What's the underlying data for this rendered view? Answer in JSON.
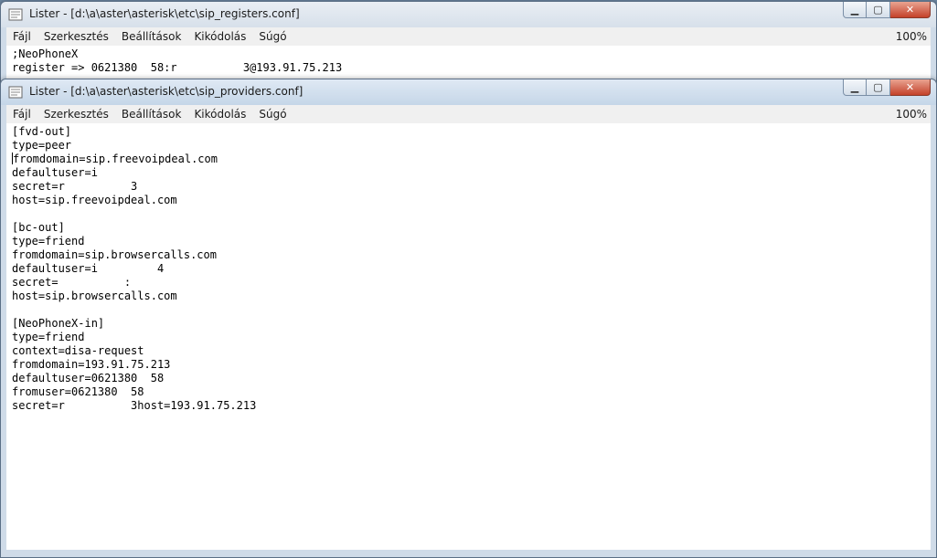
{
  "window_back": {
    "title": "Lister - [d:\\a\\aster\\asterisk\\etc\\sip_registers.conf]",
    "menu": [
      "Fájl",
      "Szerkesztés",
      "Beállítások",
      "Kikódolás",
      "Súgó"
    ],
    "zoom": "100%",
    "lines": [
      ";NeoPhoneX",
      "register => 0621380  58:r          3@193.91.75.213"
    ]
  },
  "window_front": {
    "title": "Lister - [d:\\a\\aster\\asterisk\\etc\\sip_providers.conf]",
    "menu": [
      "Fájl",
      "Szerkesztés",
      "Beállítások",
      "Kikódolás",
      "Súgó"
    ],
    "zoom": "100%",
    "lines": [
      "[fvd-out]",
      "type=peer",
      "fromdomain=sip.freevoipdeal.com",
      "defaultuser=i",
      "secret=r          3",
      "host=sip.freevoipdeal.com",
      "",
      "[bc-out]",
      "type=friend",
      "fromdomain=sip.browsercalls.com",
      "defaultuser=i         4",
      "secret=          :",
      "host=sip.browsercalls.com",
      "",
      "[NeoPhoneX-in]",
      "type=friend",
      "context=disa-request",
      "fromdomain=193.91.75.213",
      "defaultuser=0621380  58",
      "fromuser=0621380  58",
      "secret=r          3host=193.91.75.213"
    ]
  },
  "icons": {
    "app": "lister-icon",
    "minimize": "minimize-icon",
    "maximize": "maximize-icon",
    "close": "close-icon"
  }
}
